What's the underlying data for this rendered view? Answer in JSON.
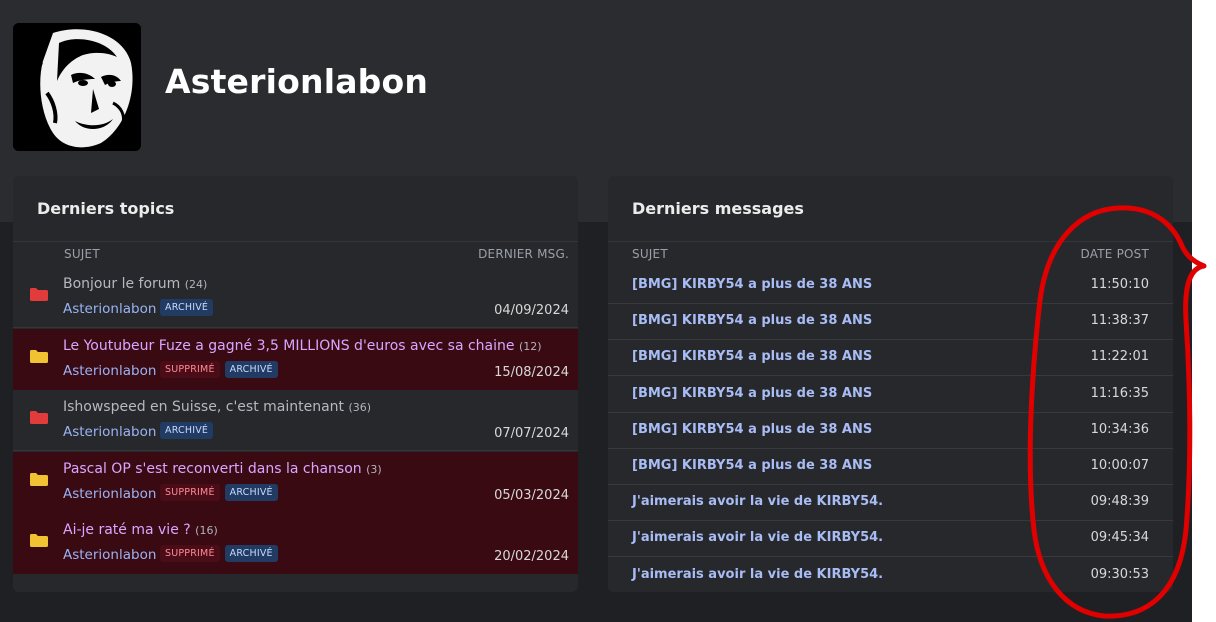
{
  "profile": {
    "username": "Asterionlabon"
  },
  "topics": {
    "title": "Derniers topics",
    "col_subject": "SUJET",
    "col_last": "DERNIER MSG.",
    "rows": [
      {
        "title": "Bonjour le forum",
        "count": "(24)",
        "author": "Asterionlabon",
        "deleted": false,
        "archived": true,
        "folder": "red",
        "date": "04/09/2024"
      },
      {
        "title": "Le Youtubeur Fuze a gagné 3,5 MILLIONS d'euros avec sa chaine",
        "count": "(12)",
        "author": "Asterionlabon",
        "deleted": true,
        "archived": true,
        "folder": "yellow",
        "date": "15/08/2024"
      },
      {
        "title": "Ishowspeed en Suisse, c'est maintenant",
        "count": "(36)",
        "author": "Asterionlabon",
        "deleted": false,
        "archived": true,
        "folder": "red",
        "date": "07/07/2024"
      },
      {
        "title": "Pascal OP s'est reconverti dans la chanson",
        "count": "(3)",
        "author": "Asterionlabon",
        "deleted": true,
        "archived": true,
        "folder": "yellow",
        "date": "05/03/2024"
      },
      {
        "title": "Ai-je raté ma vie ?",
        "count": "(16)",
        "author": "Asterionlabon",
        "deleted": true,
        "archived": true,
        "folder": "yellow",
        "date": "20/02/2024"
      }
    ],
    "badge_deleted": "SUPPRIMÉ",
    "badge_archived": "ARCHIVÉ"
  },
  "messages": {
    "title": "Derniers messages",
    "col_subject": "SUJET",
    "col_date": "DATE POST",
    "rows": [
      {
        "subject": "[BMG] KIRBY54 a plus de 38 ANS",
        "time": "11:50:10"
      },
      {
        "subject": "[BMG] KIRBY54 a plus de 38 ANS",
        "time": "11:38:37"
      },
      {
        "subject": "[BMG] KIRBY54 a plus de 38 ANS",
        "time": "11:22:01"
      },
      {
        "subject": "[BMG] KIRBY54 a plus de 38 ANS",
        "time": "11:16:35"
      },
      {
        "subject": "[BMG] KIRBY54 a plus de 38 ANS",
        "time": "10:34:36"
      },
      {
        "subject": "[BMG] KIRBY54 a plus de 38 ANS",
        "time": "10:00:07"
      },
      {
        "subject": "J'aimerais avoir la vie de KIRBY54.",
        "time": "09:48:39"
      },
      {
        "subject": "J'aimerais avoir la vie de KIRBY54.",
        "time": "09:45:34"
      },
      {
        "subject": "J'aimerais avoir la vie de KIRBY54.",
        "time": "09:30:53"
      }
    ]
  },
  "colors": {
    "background": "#1f2023",
    "header": "#2b2c30",
    "card": "#27282b",
    "deleted_row": "#3a0a12",
    "link": "#9ab3f5",
    "folder_red": "#e23b3b",
    "folder_yellow": "#f1c232",
    "annotation": "#e00000"
  },
  "icons": {
    "folder": "folder-icon"
  }
}
